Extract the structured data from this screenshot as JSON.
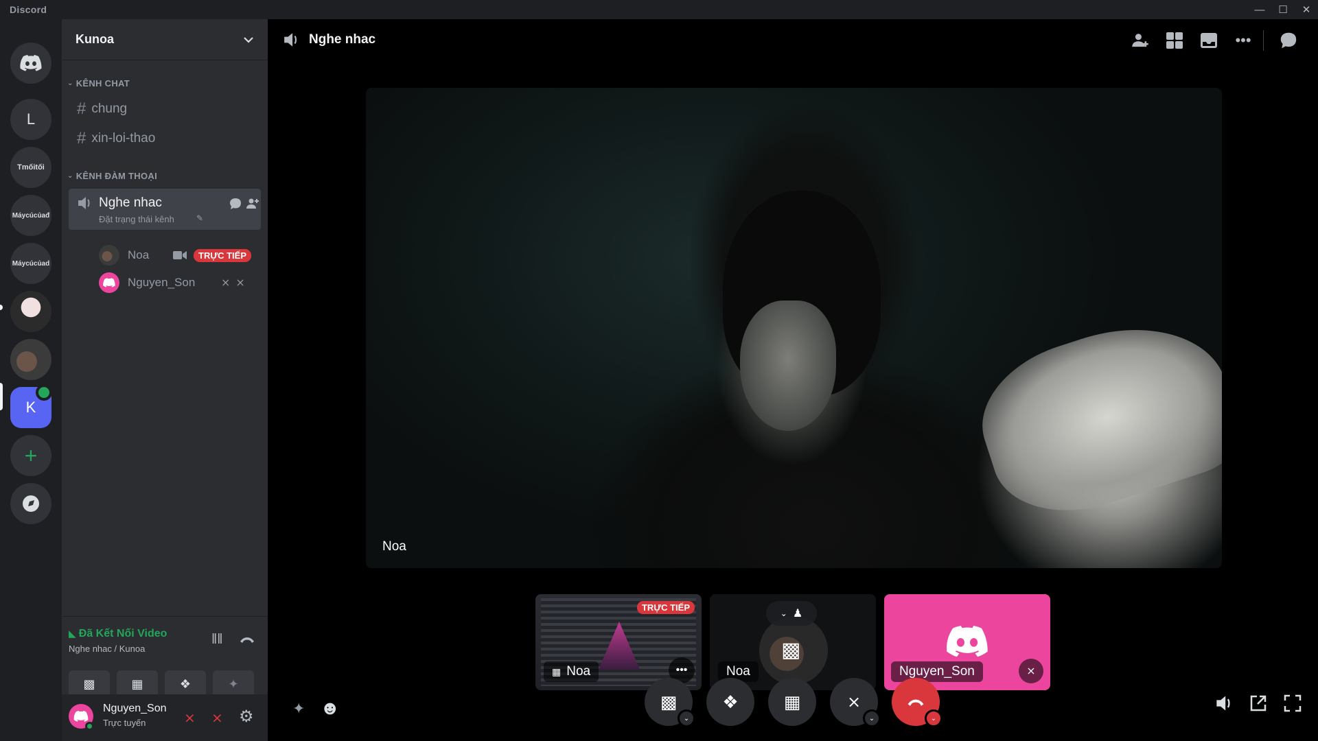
{
  "app": {
    "title": "Discord"
  },
  "window_controls": [
    "minimize-icon",
    "maximize-icon",
    "close-icon"
  ],
  "rail": {
    "servers": [
      {
        "kind": "home",
        "icon": "discord-logo-icon"
      },
      {
        "kind": "letter",
        "label": "L"
      },
      {
        "kind": "text",
        "label": "Tmốitối"
      },
      {
        "kind": "text",
        "label": "Máycúcủađ"
      },
      {
        "kind": "text",
        "label": "Máycúcủad"
      },
      {
        "kind": "avatar"
      },
      {
        "kind": "avatar"
      },
      {
        "kind": "letter",
        "label": "K",
        "active": true
      },
      {
        "kind": "add",
        "icon": "plus-icon"
      },
      {
        "kind": "discover",
        "icon": "compass-icon"
      }
    ]
  },
  "sidebar": {
    "server_name": "Kunoa",
    "text_category": "KÊNH CHAT",
    "text_channels": [
      "chung",
      "xin-loi-thao"
    ],
    "voice_category": "KÊNH ĐÀM THOẠI",
    "voice_channel": {
      "name": "Nghe nhac",
      "status": "Đặt trạng thái kênh"
    },
    "members": [
      {
        "name": "Noa",
        "badge": "TRỰC TIẾP"
      },
      {
        "name": "Nguyen_Son"
      }
    ],
    "voice_connection": {
      "status": "Đã Kết Nối Video",
      "location": "Nghe nhac / Kunoa"
    },
    "user": {
      "name": "Nguyen_Son",
      "status": "Trực tuyến"
    }
  },
  "main": {
    "channel_title": "Nghe nhac",
    "stage_label": "Noa",
    "tiles": [
      {
        "label": "Noa",
        "badge": "TRỰC TIẾP"
      },
      {
        "label": "Noa"
      },
      {
        "label": "Nguyen_Son"
      }
    ]
  },
  "colors": {
    "brand": "#5865f2",
    "live_red": "#da373c",
    "connected_green": "#23a55a",
    "user_pink": "#eb459e"
  }
}
